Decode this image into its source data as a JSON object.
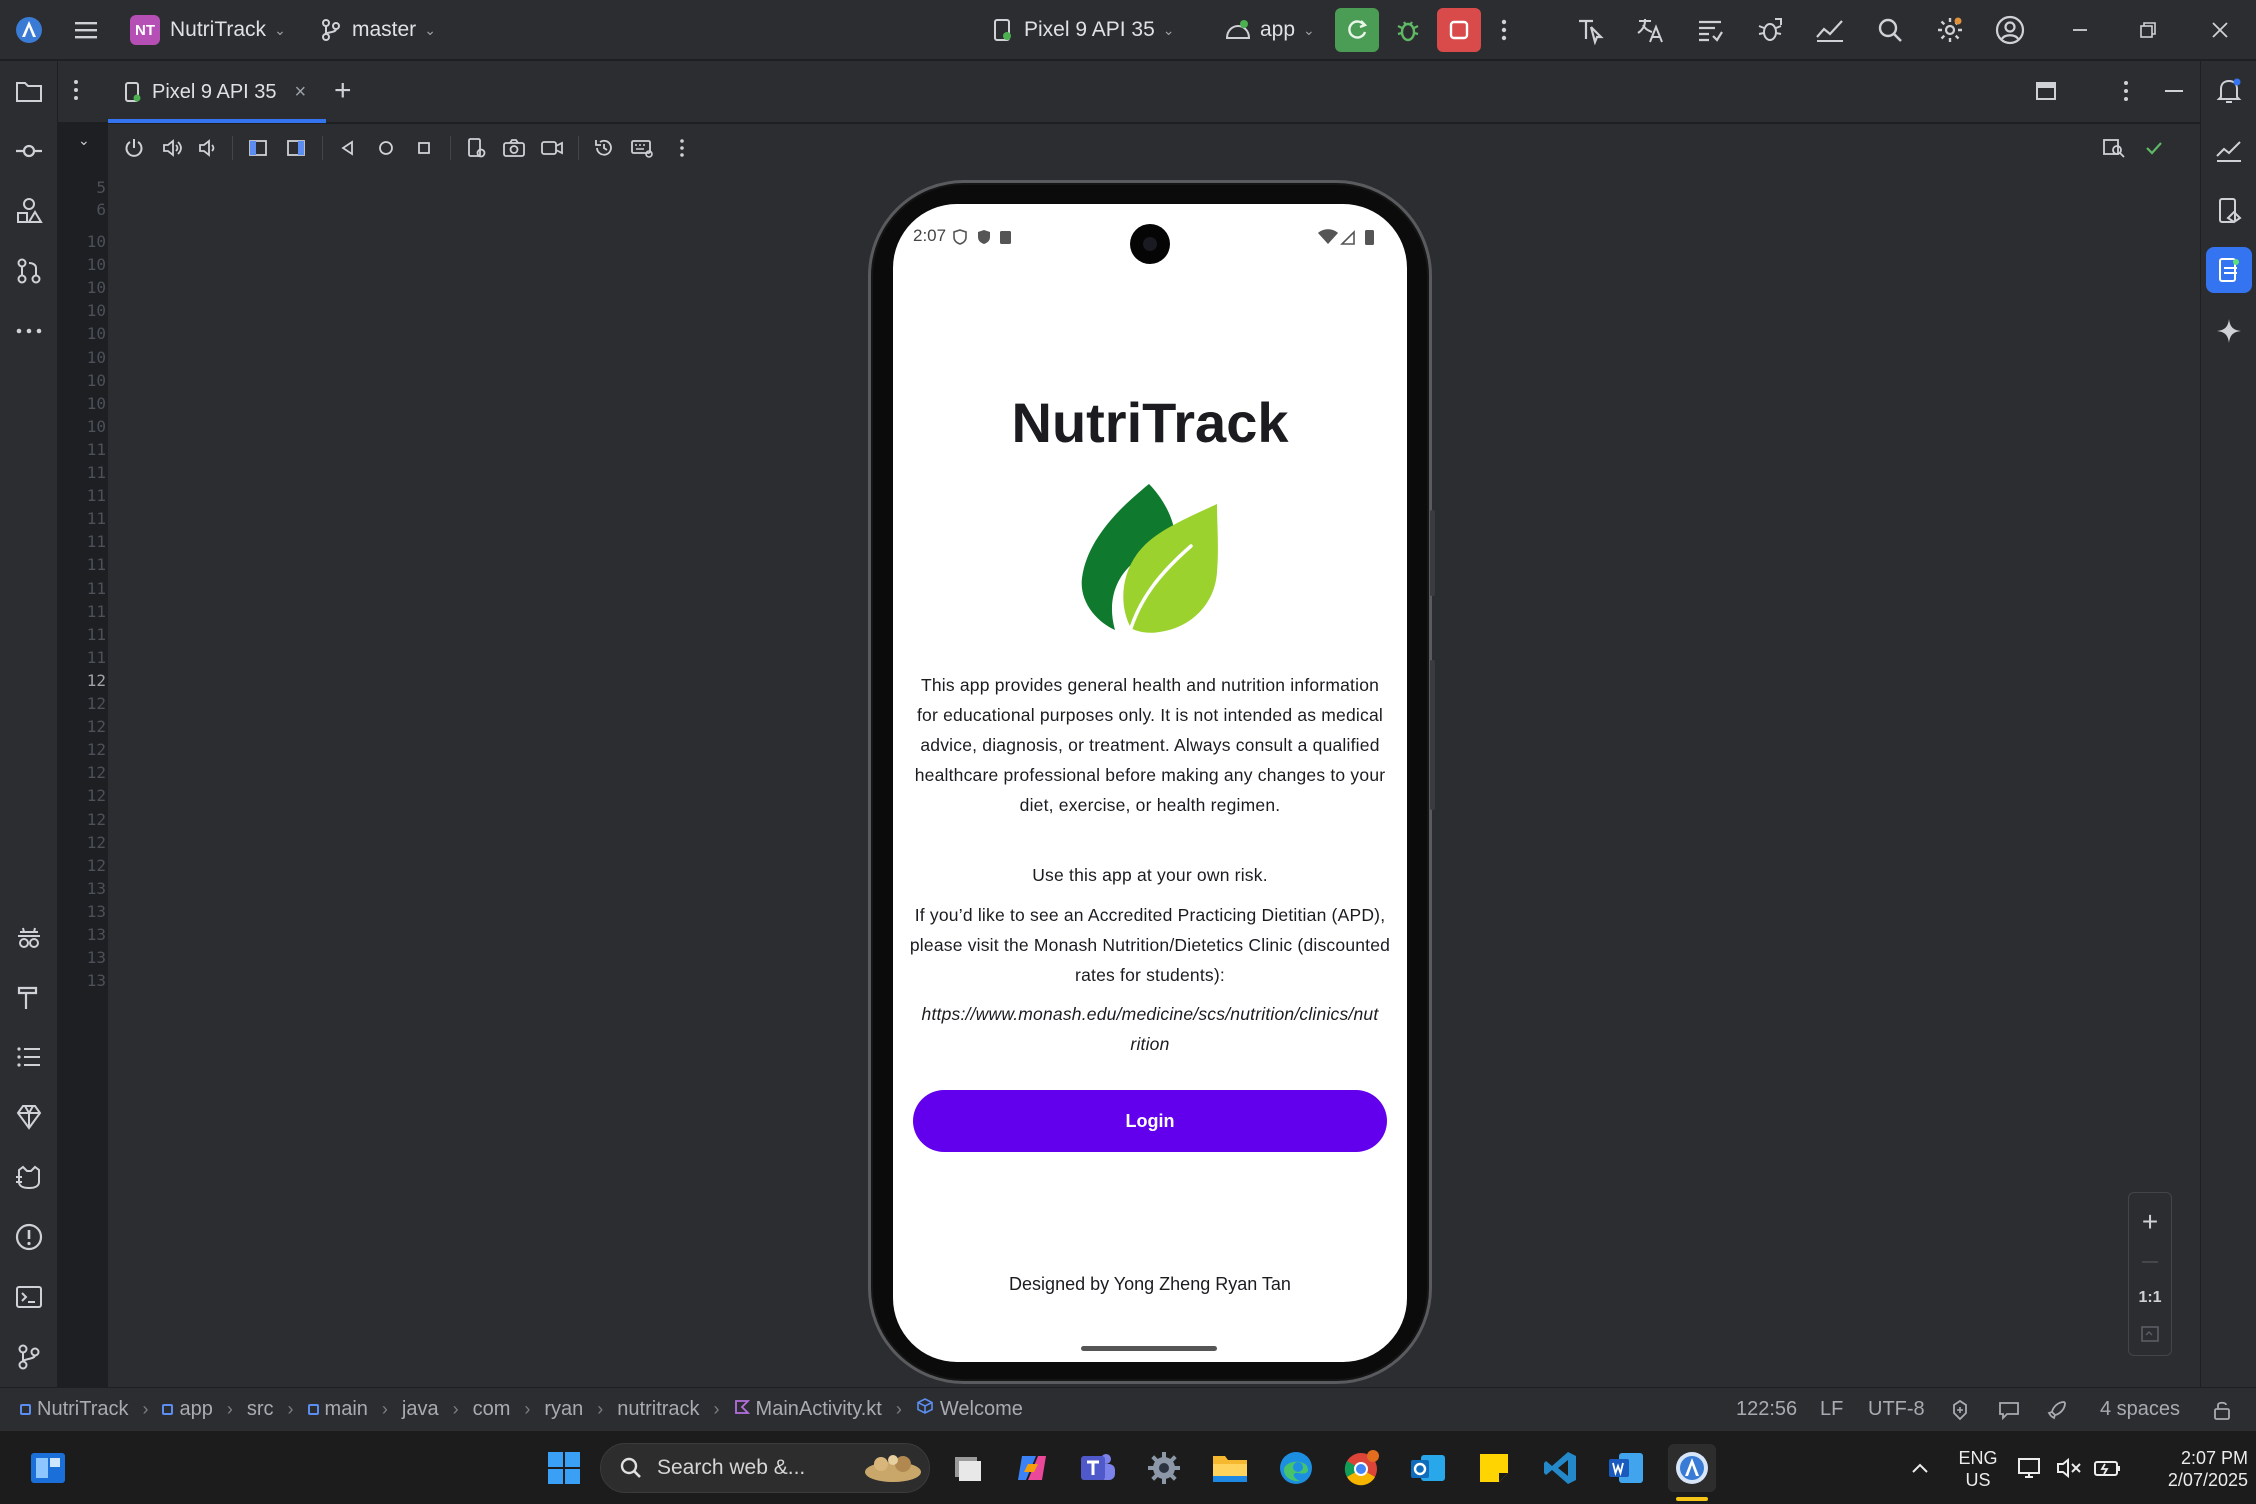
{
  "titlebar": {
    "project_initials": "NT",
    "project_name": "NutriTrack",
    "branch": "master",
    "device": "Pixel 9 API 35",
    "run_config": "app"
  },
  "tabs": [
    {
      "label": "Pixel 9 API 35"
    }
  ],
  "gutter": {
    "line_numbers": [
      "5",
      "6",
      "10",
      "10",
      "10",
      "10",
      "10",
      "10",
      "10",
      "10",
      "10",
      "11",
      "11",
      "11",
      "11",
      "11",
      "11",
      "11",
      "11",
      "11",
      "11",
      "12",
      "12",
      "12",
      "12",
      "12",
      "12",
      "12",
      "12",
      "12",
      "13",
      "13",
      "13",
      "13",
      "13"
    ],
    "current_line": "12"
  },
  "phone": {
    "status_time": "2:07",
    "app_title": "NutriTrack",
    "disclaimer": "This app provides general health and nutrition information for educational purposes only. It is not intended as medical advice, diagnosis, or treatment. Always consult a qualified healthcare professional before making any changes to your diet, exercise, or health regimen.",
    "risk_note": "Use this app at your own risk.",
    "apd_note": "If you’d like to see an Accredited Practicing Dietitian (APD), please visit the Monash Nutrition/Dietetics Clinic (discounted rates for students):",
    "clinic_url": "https://www.monash.edu/medicine/scs/nutrition/clinics/nutrition",
    "login_label": "Login",
    "credit": "Designed by Yong Zheng Ryan Tan",
    "button_color": "#6200EE"
  },
  "zoom": {
    "plus": "+",
    "minus": "—",
    "reset": "1:1"
  },
  "breadcrumb": [
    "NutriTrack",
    "app",
    "src",
    "main",
    "java",
    "com",
    "ryan",
    "nutritrack",
    "MainActivity.kt",
    "Welcome"
  ],
  "status_right": {
    "position": "122:56",
    "line_sep": "LF",
    "encoding": "UTF-8",
    "indent": "4 spaces"
  },
  "taskbar": {
    "search_placeholder": "Search web &...",
    "lang_line1": "ENG",
    "lang_line2": "US",
    "clock_time": "2:07 PM",
    "clock_date": "2/07/2025"
  },
  "colors": {
    "accent": "#3574F0",
    "run_green": "#4CAF50",
    "stop_red": "#D94A4A",
    "leaf_dark": "#0F7A2E",
    "leaf_light": "#9BD22E"
  }
}
